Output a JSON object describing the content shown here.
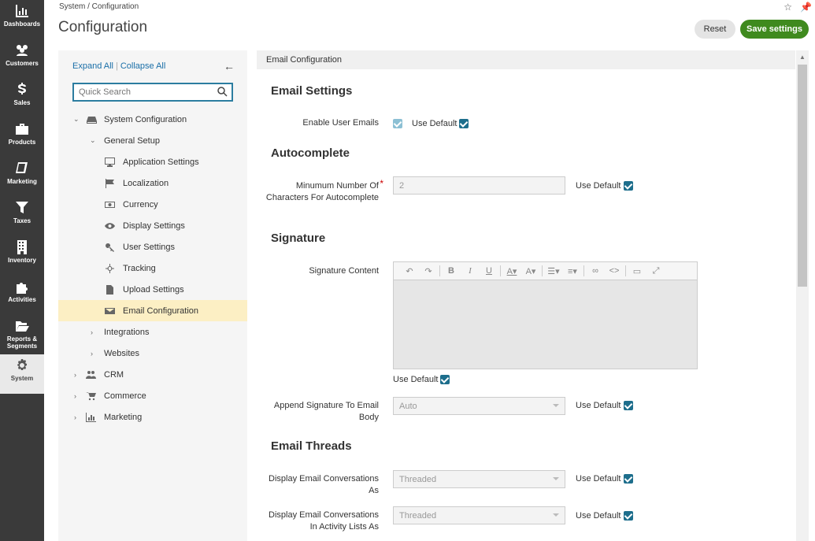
{
  "nav": [
    {
      "label": "Dashboards",
      "icon": "dashboards-icon"
    },
    {
      "label": "Customers",
      "icon": "customers-icon"
    },
    {
      "label": "Sales",
      "icon": "dollar-icon"
    },
    {
      "label": "Products",
      "icon": "briefcase-icon"
    },
    {
      "label": "Marketing",
      "icon": "book-icon"
    },
    {
      "label": "Taxes",
      "icon": "filter-icon"
    },
    {
      "label": "Inventory",
      "icon": "building-icon"
    },
    {
      "label": "Activities",
      "icon": "puzzle-icon"
    },
    {
      "label": "Reports & Segments",
      "icon": "folder-open-icon"
    },
    {
      "label": "System",
      "icon": "gear-icon"
    }
  ],
  "header": {
    "breadcrumb": "System / Configuration",
    "title": "Configuration",
    "reset_label": "Reset",
    "save_label": "Save settings"
  },
  "tree": {
    "expand_all": "Expand All",
    "collapse_all": "Collapse All",
    "search_placeholder": "Quick Search",
    "items": [
      {
        "label": "System Configuration",
        "icon": "drive-icon"
      },
      {
        "label": "General Setup"
      },
      {
        "label": "Application Settings",
        "icon": "monitor-icon"
      },
      {
        "label": "Localization",
        "icon": "flag-icon"
      },
      {
        "label": "Currency",
        "icon": "money-icon"
      },
      {
        "label": "Display Settings",
        "icon": "eye-icon"
      },
      {
        "label": "User Settings",
        "icon": "key-icon"
      },
      {
        "label": "Tracking",
        "icon": "crosshair-icon"
      },
      {
        "label": "Upload Settings",
        "icon": "file-icon"
      },
      {
        "label": "Email Configuration",
        "icon": "envelope-icon"
      },
      {
        "label": "Integrations"
      },
      {
        "label": "Websites"
      },
      {
        "label": "CRM",
        "icon": "users-icon"
      },
      {
        "label": "Commerce",
        "icon": "cart-icon"
      },
      {
        "label": "Marketing",
        "icon": "bar-chart-icon"
      }
    ]
  },
  "main": {
    "section_title": "Email Configuration",
    "email_settings": {
      "heading": "Email Settings",
      "enable_user_emails_label": "Enable User Emails",
      "use_default": "Use Default"
    },
    "autocomplete": {
      "heading": "Autocomplete",
      "min_chars_label": "Minumum Number Of Characters For Autocomplete",
      "min_chars_value": "2",
      "use_default": "Use Default"
    },
    "signature": {
      "heading": "Signature",
      "content_label": "Signature Content",
      "use_default": "Use Default",
      "append_label": "Append Signature To Email Body",
      "append_value": "Auto",
      "append_use_default": "Use Default"
    },
    "threads": {
      "heading": "Email Threads",
      "display_as_label": "Display Email Conversations As",
      "display_as_value": "Threaded",
      "use_default_1": "Use Default",
      "activity_lists_label": "Display Email Conversations In Activity Lists As",
      "activity_lists_value": "Threaded",
      "use_default_2": "Use Default"
    }
  },
  "colors": {
    "nav_bg": "#3a3a3a",
    "accent": "#1d6e8c",
    "save_button": "#3f8a1e",
    "selected_item": "#fcefc4"
  }
}
